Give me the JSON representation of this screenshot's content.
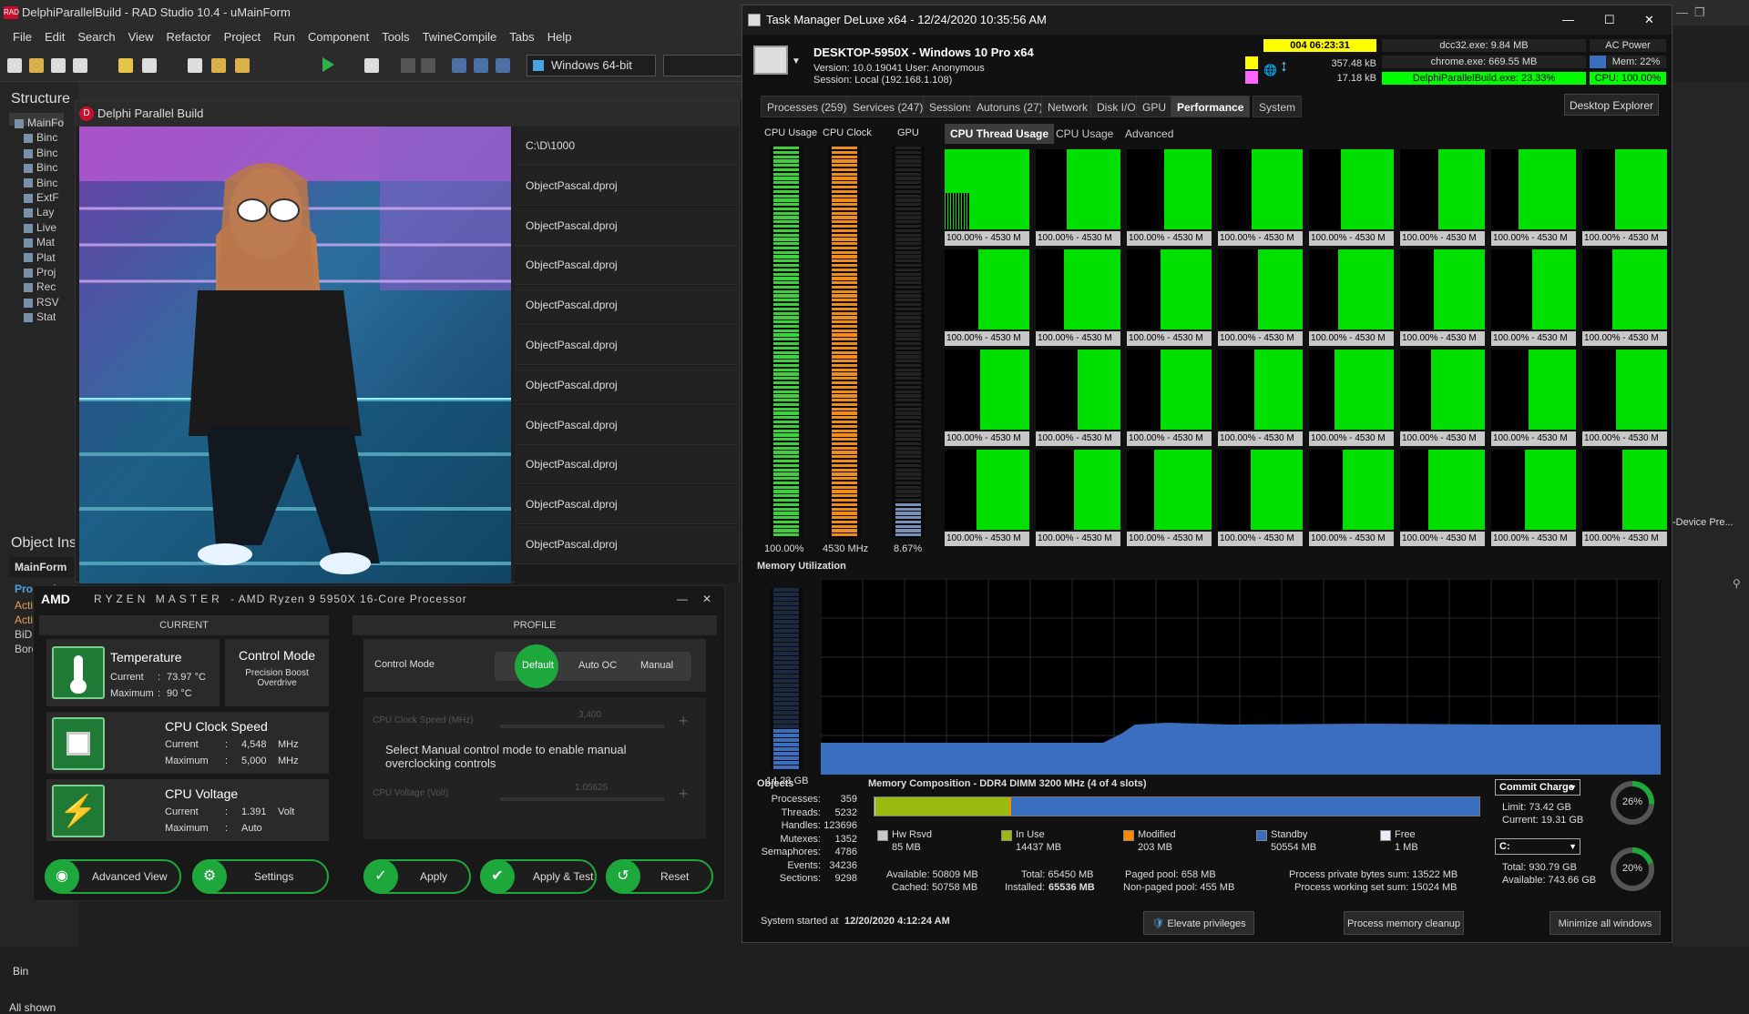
{
  "ide": {
    "title": "DelphiParallelBuild - RAD Studio 10.4 - uMainForm",
    "menu": [
      "File",
      "Edit",
      "Search",
      "View",
      "Refactor",
      "Project",
      "Run",
      "Component",
      "Tools",
      "TwineCompile",
      "Tabs",
      "Help"
    ],
    "platform": "Windows 64-bit",
    "structure_title": "Structure",
    "structure_items": [
      "MainFo",
      "Binc",
      "Binc",
      "Binc",
      "Binc",
      "ExtF",
      "Lay",
      "Live",
      "Mat",
      "Plat",
      "Proj",
      "Rec",
      "RSV",
      "Stat"
    ],
    "object_inspector_title": "Object Ins",
    "object_inspector_selected": "MainForm",
    "properties_tab": "Properties",
    "properties": [
      "Action",
      "ActiveCo",
      "BiDiMode",
      "Border"
    ],
    "bottom_label": "Bin",
    "status": "All shown",
    "right_fragment": "-Device Pre..."
  },
  "dpb": {
    "title": "Delphi Parallel Build",
    "items": [
      "C:\\D\\1000",
      "ObjectPascal.dproj",
      "ObjectPascal.dproj",
      "ObjectPascal.dproj",
      "ObjectPascal.dproj",
      "ObjectPascal.dproj",
      "ObjectPascal.dproj",
      "ObjectPascal.dproj",
      "ObjectPascal.dproj",
      "ObjectPascal.dproj",
      "ObjectPascal.dproj"
    ]
  },
  "ryzen": {
    "brand": "AMD",
    "title": "RYZEN MASTER",
    "processor": "- AMD Ryzen 9 5950X 16-Core Processor",
    "current_header": "CURRENT",
    "profile_header": "PROFILE",
    "temperature": {
      "label": "Temperature",
      "current_label": "Current",
      "current": "73.97 °C",
      "max_label": "Maximum",
      "max": "90 °C"
    },
    "control_mode": {
      "label": "Control Mode",
      "value": "Precision Boost Overdrive"
    },
    "cpu_clock": {
      "label": "CPU Clock Speed",
      "current_label": "Current",
      "current": "4,548",
      "current_unit": "MHz",
      "max_label": "Maximum",
      "max": "5,000",
      "max_unit": "MHz"
    },
    "cpu_voltage": {
      "label": "CPU Voltage",
      "current_label": "Current",
      "current": "1.391",
      "current_unit": "Volt",
      "max_label": "Maximum",
      "max": "Auto"
    },
    "profile_control_mode": "Control Mode",
    "modes": [
      "Default",
      "Auto OC",
      "Manual"
    ],
    "disabled_clock_label": "CPU Clock Speed (MHz)",
    "disabled_clock_value": "3,400",
    "disabled_voltage_label": "CPU Voltage (Volt)",
    "disabled_voltage_value": "1.05625",
    "hint": "Select Manual control mode to enable manual overclocking controls",
    "buttons": [
      "Advanced View",
      "Settings",
      "Apply",
      "Apply & Test",
      "Reset"
    ]
  },
  "tm": {
    "title": "Task Manager DeLuxe x64 - 12/24/2020 10:35:56 AM",
    "host": "DESKTOP-5950X - Windows 10 Pro x64",
    "version": "Version: 10.0.19041   User: Anonymous",
    "session": "Session: Local (192.168.1.108)",
    "uptime": "004 06:23:31",
    "net_up": "357.48 kB",
    "net_down": "17.18 kB",
    "top_procs": [
      "dcc32.exe: 9.84 MB",
      "chrome.exe: 669.55 MB",
      "DelphiParallelBuild.exe: 23.33%"
    ],
    "power": "AC Power",
    "mem_pct": "Mem: 22%",
    "cpu_pct": "CPU: 100.00%",
    "tabs": [
      "Processes (259)",
      "Services (247)",
      "Sessions",
      "Autoruns (27)",
      "Network",
      "Disk I/O",
      "GPU",
      "Performance",
      "System"
    ],
    "desktop_explorer": "Desktop Explorer",
    "meters": {
      "cpu_usage_label": "CPU Usage",
      "cpu_clock_label": "CPU Clock",
      "gpu_label": "GPU",
      "cpu_usage": "100.00%",
      "cpu_clock": "4530 MHz",
      "gpu": "8.67%"
    },
    "subtabs": [
      "CPU Thread Usage",
      "CPU Usage",
      "Advanced"
    ],
    "thread_label": "100.00% - 4530 M",
    "memory_title": "Memory Utilization",
    "memory_used": "14.23 GB",
    "objects": {
      "title": "Objects",
      "rows": [
        [
          "Processes:",
          "359"
        ],
        [
          "Threads:",
          "5232"
        ],
        [
          "Handles:",
          "123696"
        ],
        [
          "Mutexes:",
          "1352"
        ],
        [
          "Semaphores:",
          "4786"
        ],
        [
          "Events:",
          "34236"
        ],
        [
          "Sections:",
          "9298"
        ]
      ]
    },
    "composition_title": "Memory Composition - DDR4 DIMM 3200 MHz (4 of 4 slots)",
    "legend": [
      {
        "label": "Hw Rsvd",
        "value": "85 MB",
        "color": "#c8c8c8"
      },
      {
        "label": "In Use",
        "value": "14437 MB",
        "color": "#99bb11"
      },
      {
        "label": "Modified",
        "value": "203 MB",
        "color": "#ff8800"
      },
      {
        "label": "Standby",
        "value": "50554 MB",
        "color": "#3a6fbf"
      },
      {
        "label": "Free",
        "value": "1 MB",
        "color": "#e8eef8"
      }
    ],
    "available": "Available: 50809 MB",
    "cached": "Cached: 50758 MB",
    "total": "Total: 65450 MB",
    "installed_label": "Installed:",
    "installed": "65536 MB",
    "paged": "Paged pool: 658 MB",
    "nonpaged": "Non-paged pool: 455 MB",
    "private_bytes": "Process private bytes sum: 13522 MB",
    "working_set": "Process working set sum: 15024 MB",
    "commit": {
      "label": "Commit Charge",
      "limit": "Limit: 73.42 GB",
      "current": "Current: 19.31 GB",
      "pct": "26%",
      "fraction": 0.26
    },
    "drive": {
      "label": "C:",
      "total": "Total: 930.79 GB",
      "available": "Available: 743.66 GB",
      "pct": "20%",
      "fraction": 0.2
    },
    "system_started_label": "System started at",
    "system_started": "12/20/2020 4:12:24 AM",
    "elevate": "Elevate privileges",
    "cleanup": "Process memory cleanup",
    "minimize": "Minimize all windows"
  }
}
